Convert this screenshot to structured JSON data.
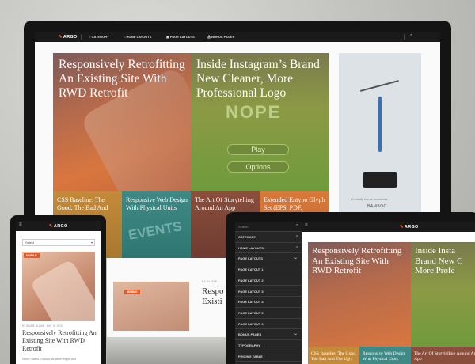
{
  "brand": {
    "name": "ARGO"
  },
  "nav": {
    "category": "CATEGORY",
    "home_layouts": "HOME LAYOUTS",
    "page_layouts": "PAGE LAYOUTS",
    "bonus_pages": "BONUS PAGES"
  },
  "desktop": {
    "hero_left": "Responsively Retrofitting An Existing Site With RWD Retrofit",
    "hero_right": "Inside Instagram’s Brand New Cleaner, More Professional Logo",
    "game_title": "NOPE",
    "game_play": "Play",
    "game_options": "Options",
    "small_1": "CSS Baseline: The Good, The Bad And",
    "small_2": "Responsive Web Design With Physical Units",
    "small_3": "The Art Of Storytelling Around An App",
    "small_4": "Extended Entypo Glyph Set (EPS, PDF,",
    "ad_caption": "Creativity has no boundaries",
    "ad_brand": "BAMBOO",
    "events_word": "EVENTS",
    "lower_meta": "BY BLUME",
    "lower_title": "Respo Existi",
    "lower_badge": "MOBILE"
  },
  "phone": {
    "select_value": "Select",
    "badge": "MOBILE",
    "meta": "BY BLUME BLUME · MAY 19, 2015",
    "title": "Responsively Retrofitting An Existing Site With RWD Retrofit",
    "excerpt": "Nunc mattis, mauris sit amet imperdiet"
  },
  "tablet": {
    "search_placeholder": "Search",
    "menu": [
      "CATEGORY",
      "HOME LAYOUTS",
      "PAGE LAYOUTS",
      "PAGE LAYOUT 1",
      "PAGE LAYOUT 2",
      "PAGE LAYOUT 3",
      "PAGE LAYOUT 4",
      "PAGE LAYOUT 5",
      "PAGE LAYOUT 6",
      "BONUS PAGES",
      "TYPOGRAPHY",
      "PRICING TABLE"
    ],
    "hero_left": "Responsively Retrofitting An Existing Site With RWD Retrofit",
    "hero_right": "Inside Insta Brand New C More Profe",
    "small_1": "CSS Baseline: The Good, The Bad And The Ugly",
    "small_2": "Responsive Web Design With Physical Units",
    "small_3": "The Art Of Storytelling Around An App"
  },
  "colors": {
    "accent": "#e35c2a",
    "dark": "#141414"
  }
}
